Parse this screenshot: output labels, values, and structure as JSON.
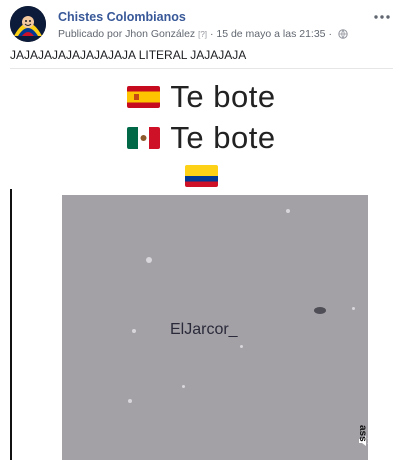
{
  "post": {
    "page_name": "Chistes Colombianos",
    "published_prefix": "Publicado por",
    "author": "Jhon González",
    "author_mark": "[?]",
    "separator": "·",
    "timestamp": "15 de mayo a las 21:35",
    "more_icon": "more-horizontal-icon",
    "caption": "JAJAJAJAJAJAJAJAJA LITERAL JAJAJAJA"
  },
  "media": {
    "line1_text": "Te bote",
    "line2_text": "Te bote",
    "flags": [
      "spain-flag-icon",
      "mexico-flag-icon",
      "colombia-flag-icon"
    ],
    "watermark": "ElJarcor_",
    "corner_badge": "ass",
    "video_bg_color": "#a3a1a6"
  }
}
